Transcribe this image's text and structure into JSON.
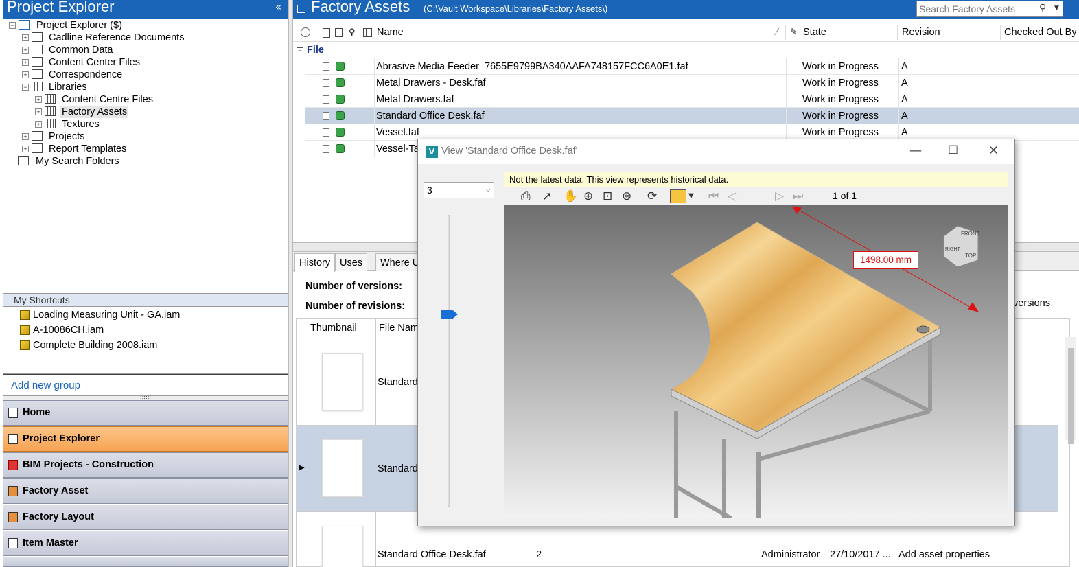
{
  "left_panel": {
    "title": "Project Explorer",
    "collapse_glyph": "«",
    "tree": [
      {
        "label": "Project Explorer ($)"
      },
      {
        "label": "Cadline Reference Documents"
      },
      {
        "label": "Common Data"
      },
      {
        "label": "Content Center Files"
      },
      {
        "label": "Correspondence"
      },
      {
        "label": "Libraries"
      },
      {
        "label": "Content Centre Files"
      },
      {
        "label": "Factory Assets"
      },
      {
        "label": "Textures"
      },
      {
        "label": "Projects"
      },
      {
        "label": "Report Templates"
      },
      {
        "label": "My Search Folders"
      }
    ],
    "shortcuts_title": "My Shortcuts",
    "shortcuts": [
      {
        "label": "Loading Measuring Unit - GA.iam"
      },
      {
        "label": "A-10086CH.iam"
      },
      {
        "label": "Complete Building 2008.iam"
      }
    ],
    "add_group": "Add new group",
    "nav": [
      {
        "label": "Home"
      },
      {
        "label": "Project Explorer"
      },
      {
        "label": "BIM Projects - Construction"
      },
      {
        "label": "Factory Asset"
      },
      {
        "label": "Factory Layout"
      },
      {
        "label": "Item Master"
      }
    ]
  },
  "main": {
    "title": "Factory Assets",
    "path": "(C:\\Vault Workspace\\Libraries\\Factory Assets\\)",
    "search_placeholder": "Search Factory Assets",
    "columns": {
      "name": "Name",
      "state": "State",
      "revision": "Revision",
      "checked_out_by": "Checked Out By"
    },
    "group_label": "File",
    "files": [
      {
        "name": "Abrasive Media Feeder_7655E9799BA340AAFA748157FCC6A0E1.faf",
        "state": "Work in Progress",
        "revision": "A"
      },
      {
        "name": "Metal Drawers - Desk.faf",
        "state": "Work in Progress",
        "revision": "A"
      },
      {
        "name": "Metal Drawers.faf",
        "state": "Work in Progress",
        "revision": "A"
      },
      {
        "name": "Standard Office Desk.faf",
        "state": "Work in Progress",
        "revision": "A"
      },
      {
        "name": "Vessel.faf",
        "state": "Work in Progress",
        "revision": "A"
      },
      {
        "name": "Vessel-Ta",
        "state": "",
        "revision": ""
      }
    ],
    "tabs": [
      {
        "label": "History"
      },
      {
        "label": "Uses"
      },
      {
        "label": "Where U"
      }
    ],
    "num_versions_label": "Number of versions:",
    "num_revisions_label": "Number of revisions:",
    "versions_fragment": "versions",
    "history_headers": {
      "thumbnail": "Thumbnail",
      "file_name": "File Nam"
    },
    "history_rows": [
      {
        "file_name": "Standard"
      },
      {
        "file_name": "Standard"
      },
      {
        "file_name": "Standard Office Desk.faf",
        "version": "2",
        "created_by": "Administrator",
        "date": "27/10/2017 ...",
        "comment": "Add asset properties"
      }
    ]
  },
  "viewer": {
    "title": "View 'Standard Office Desk.faf'",
    "logo": "V",
    "version_select": "3",
    "notice": "Not the latest data. This view represents historical data.",
    "page_indicator": "1 of 1",
    "dimension": "1498.00 mm",
    "viewcube": {
      "top": "TOP",
      "front": "FRONT",
      "right": "RIGHT"
    }
  }
}
